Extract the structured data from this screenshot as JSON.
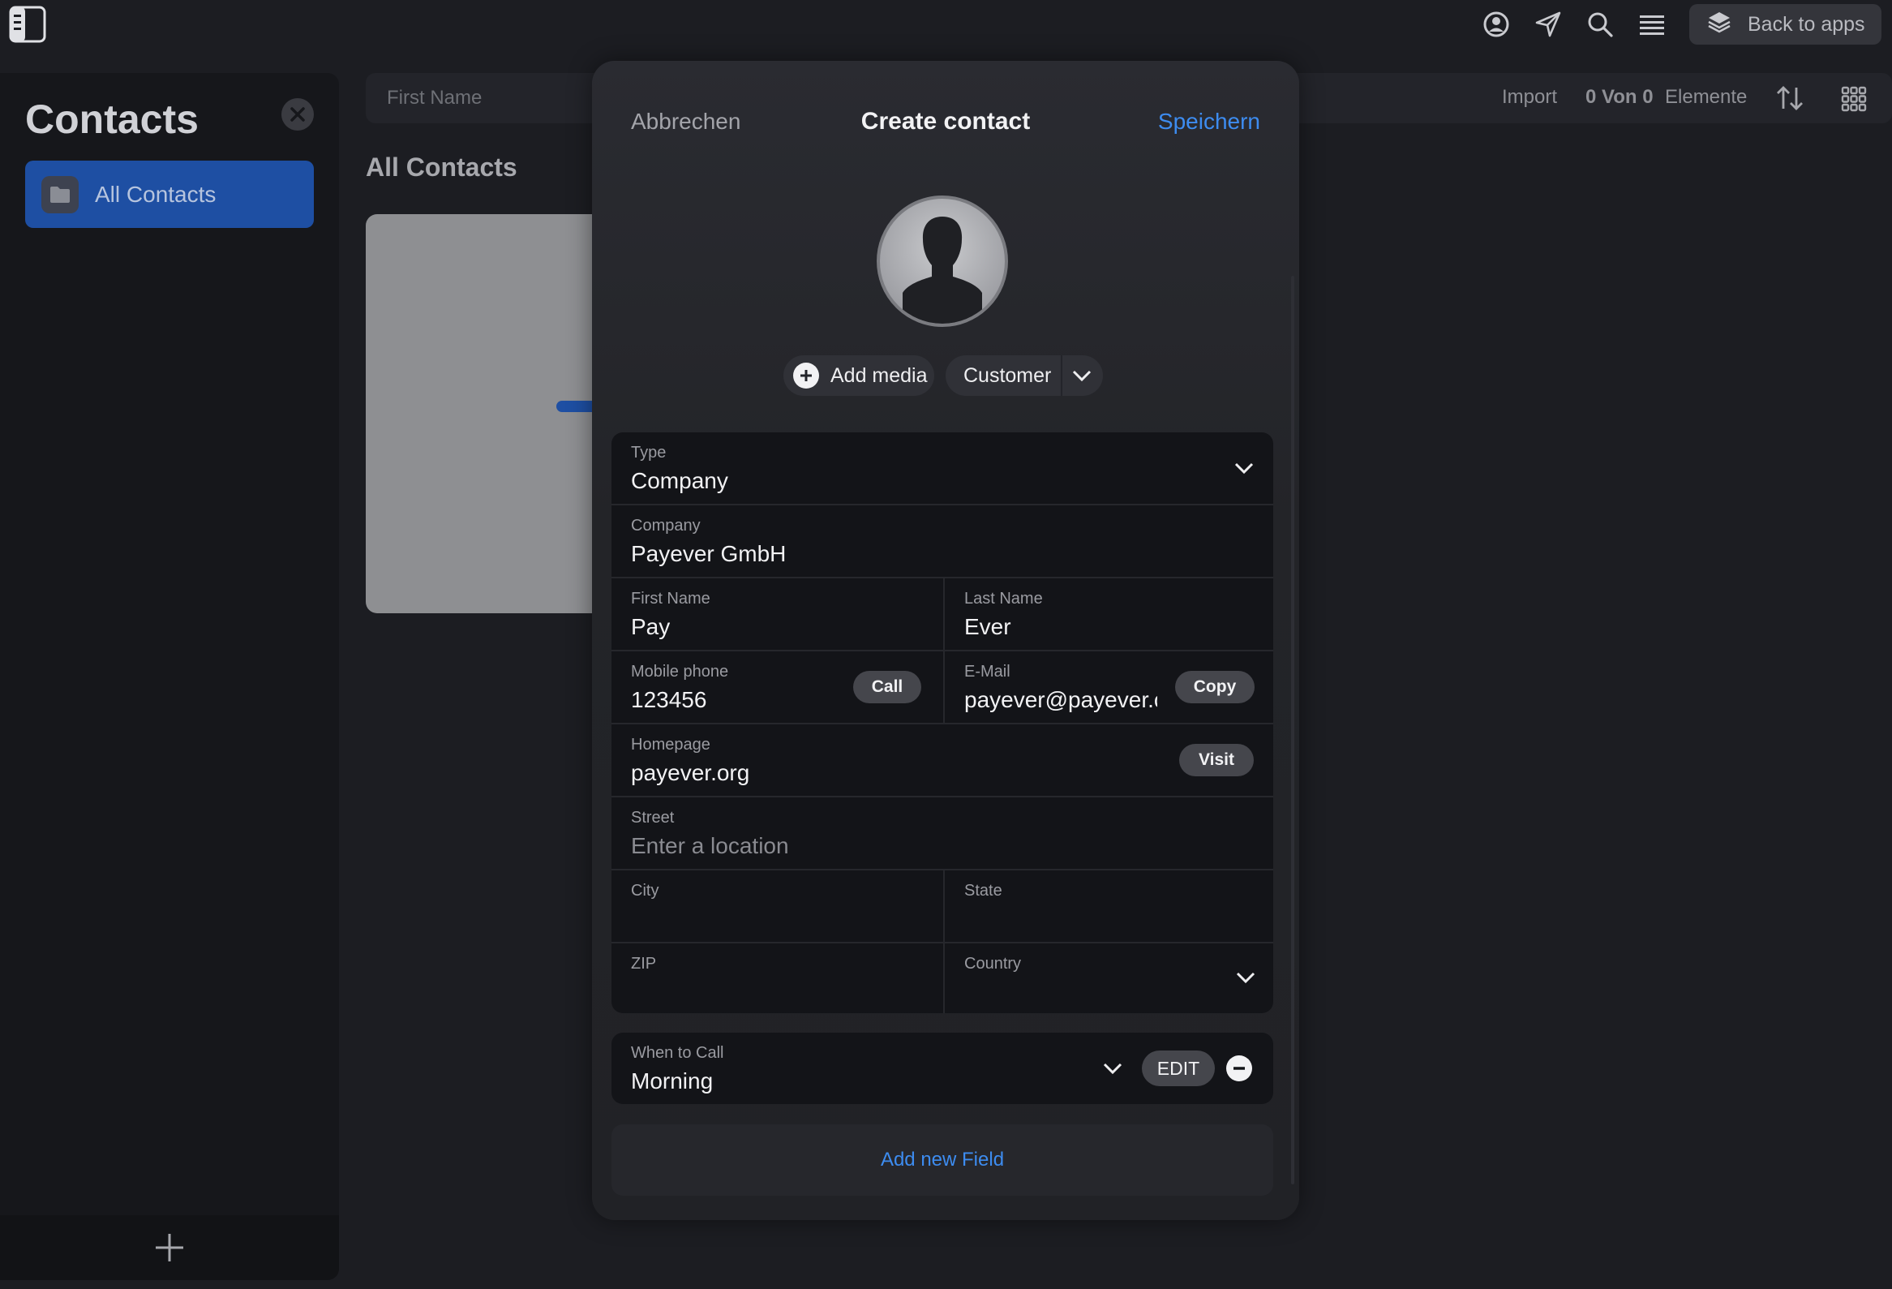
{
  "topbar": {
    "back_to_apps_label": "Back to apps"
  },
  "sidebar": {
    "title": "Contacts",
    "items": [
      {
        "label": "All Contacts"
      }
    ]
  },
  "main": {
    "search_placeholder": "First Name",
    "import_label": "Import",
    "count_text": "0 Von 0",
    "elements_label": "Elemente",
    "section_title": "All Contacts"
  },
  "modal": {
    "cancel_label": "Abbrechen",
    "title": "Create contact",
    "save_label": "Speichern",
    "add_media_label": "Add media",
    "role_value": "Customer",
    "fields": {
      "type": {
        "label": "Type",
        "value": "Company"
      },
      "company": {
        "label": "Company",
        "value": "Payever GmbH"
      },
      "first_name": {
        "label": "First Name",
        "value": "Pay"
      },
      "last_name": {
        "label": "Last Name",
        "value": "Ever"
      },
      "mobile_phone": {
        "label": "Mobile phone",
        "value": "123456",
        "action": "Call"
      },
      "email": {
        "label": "E-Mail",
        "value": "payever@payever.org",
        "action": "Copy"
      },
      "homepage": {
        "label": "Homepage",
        "value": "payever.org",
        "action": "Visit"
      },
      "street": {
        "label": "Street",
        "placeholder": "Enter a location"
      },
      "city": {
        "label": "City",
        "value": ""
      },
      "state": {
        "label": "State",
        "value": ""
      },
      "zip": {
        "label": "ZIP",
        "value": ""
      },
      "country": {
        "label": "Country",
        "value": ""
      }
    },
    "when_to_call": {
      "label": "When to Call",
      "value": "Morning",
      "edit_label": "EDIT"
    },
    "add_field_label": "Add new Field"
  },
  "colors": {
    "accent": "#3d8cf0",
    "sidebar_active": "#1e4fa3",
    "background": "#1c1d22"
  }
}
